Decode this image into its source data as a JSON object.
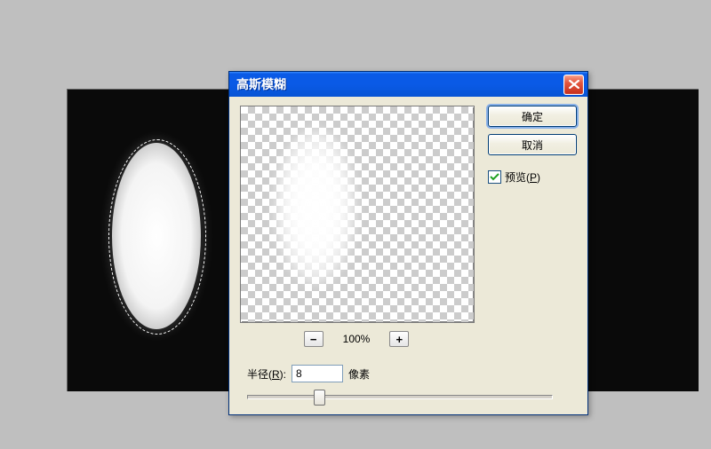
{
  "canvas": {},
  "dialog": {
    "title": "高斯模糊",
    "close_icon": "close-icon",
    "buttons": {
      "ok": "确定",
      "cancel": "取消"
    },
    "preview_checkbox": {
      "label_pre": "预览(",
      "label_hot": "P",
      "label_post": ")",
      "checked": true
    },
    "zoom": {
      "minus": "−",
      "label": "100%",
      "plus": "+"
    },
    "radius": {
      "label_pre": "半径(",
      "label_hot": "R",
      "label_post": "):",
      "value": "8",
      "unit": "像素"
    }
  }
}
